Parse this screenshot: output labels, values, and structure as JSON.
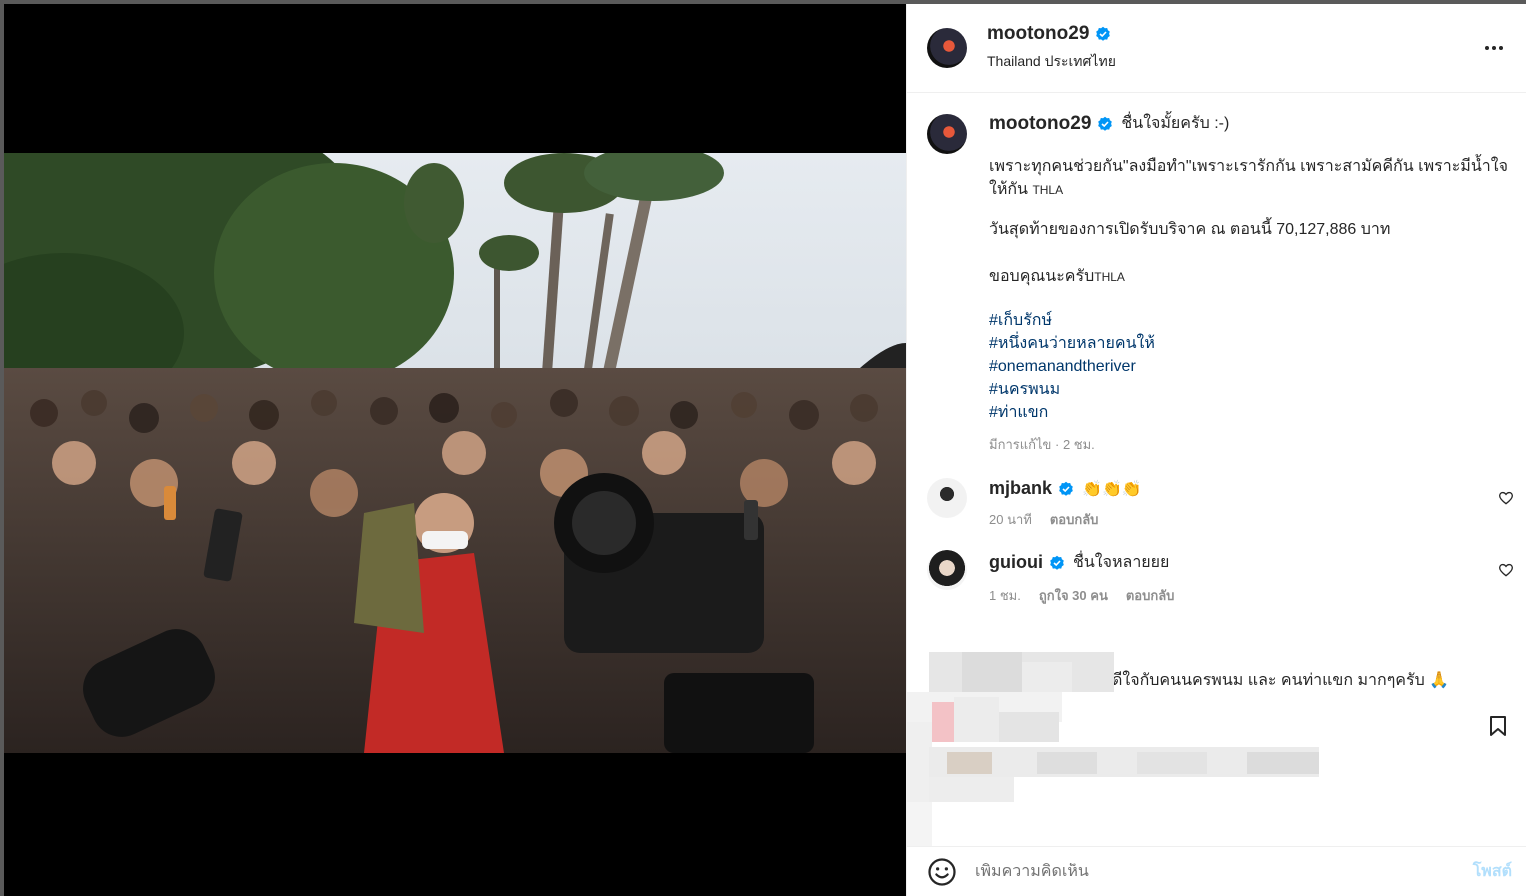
{
  "post": {
    "username": "mootono29",
    "location": "Thailand ประเทศไทย",
    "caption_username": "mootono29",
    "caption_title": "ชื่นใจมั้ยครับ :-)",
    "caption_para1": "เพราะทุกคนช่วยกัน\"ลงมือทำ\"เพราะเรารักกัน เพราะสามัคคีกัน เพราะมีน้ำใจให้กัน",
    "caption_para1_tag": "THLA",
    "caption_para2": "วันสุดท้ายของการเปิดรับบริจาค ณ ตอนนี้ 70,127,886 บาท",
    "caption_para3": "ขอบคุณนะครับ",
    "caption_para3_tag": "THLA",
    "hashtags": [
      "#เก็บรักษ์",
      "#หนึ่งคนว่ายหลายคนให้",
      "#onemanandtheriver",
      "#นครพนม",
      "#ท่าแขก"
    ],
    "meta": "มีการแก้ไข · 2 ชม."
  },
  "comments": [
    {
      "username": "mjbank",
      "text": "👏👏👏",
      "time": "20 นาที",
      "likes": "",
      "reply": "ตอบกลับ"
    },
    {
      "username": "guioui",
      "text": "ชื่นใจหลายยย",
      "time": "1 ชม.",
      "likes": "ถูกใจ 30 คน",
      "reply": "ตอบกลับ"
    }
  ],
  "partial_comment": "ดีใจกับคนนครพนม และ คนท่าแขก มากๆครับ 🙏",
  "composer": {
    "placeholder": "เพิ่มความคิดเห็น",
    "post_label": "โพสต์"
  },
  "colors": {
    "verified": "#0095f6",
    "link": "#00376b",
    "muted": "#8e8e8e",
    "post_disabled": "#b2dffc"
  },
  "icons": [
    "verified-badge-icon",
    "more-options-icon",
    "heart-icon",
    "emoji-icon",
    "bookmark-icon"
  ]
}
